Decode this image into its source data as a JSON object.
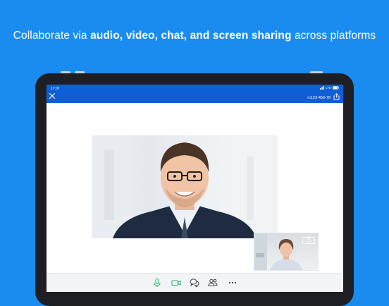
{
  "headline": {
    "prefix": "Collaborate via ",
    "bold": "audio, video, chat, and screen sharing",
    "suffix": " across platforms"
  },
  "status_bar": {
    "time": "17:07",
    "network": "LTE"
  },
  "meeting": {
    "id": "m123-456-78"
  },
  "icons": {
    "close": "close-icon",
    "share": "share-icon",
    "camera_switch": "camera-switch-icon",
    "mic": "microphone-icon",
    "video": "video-camera-icon",
    "chat": "chat-bubbles-icon",
    "participants": "participants-icon",
    "more": "more-icon"
  },
  "colors": {
    "background": "#1a8cf0",
    "topbar": "#0e5fd6",
    "accent_green": "#2fb36b",
    "toolbar_icon": "#3a3f45"
  }
}
